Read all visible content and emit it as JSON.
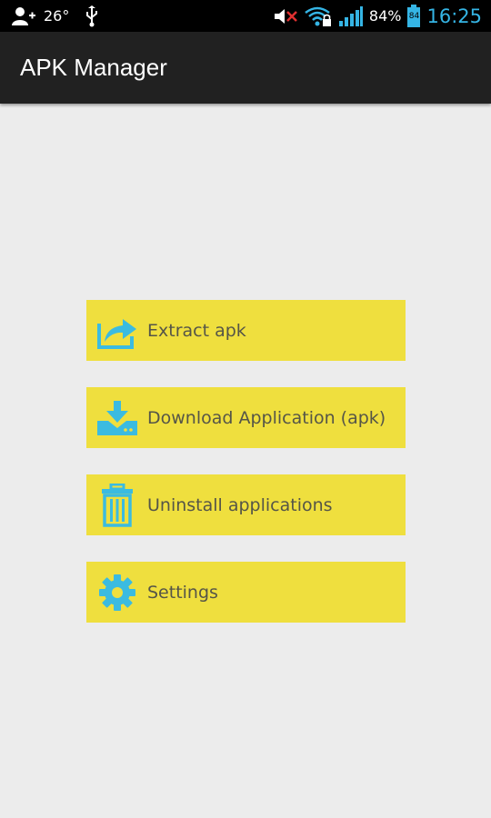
{
  "status_bar": {
    "temperature": "26°",
    "battery_percent": "84%",
    "battery_level": "84",
    "time": "16:25"
  },
  "action_bar": {
    "title": "APK Manager"
  },
  "menu": {
    "items": [
      {
        "label": "Extract apk",
        "icon": "share-icon"
      },
      {
        "label": "Download Application (apk)",
        "icon": "download-icon"
      },
      {
        "label": "Uninstall applications",
        "icon": "trash-icon"
      },
      {
        "label": "Settings",
        "icon": "gear-icon"
      }
    ]
  },
  "colors": {
    "button_bg": "#efdf3e",
    "icon": "#3bbbe0",
    "action_bar": "#212121",
    "background": "#ececec"
  }
}
